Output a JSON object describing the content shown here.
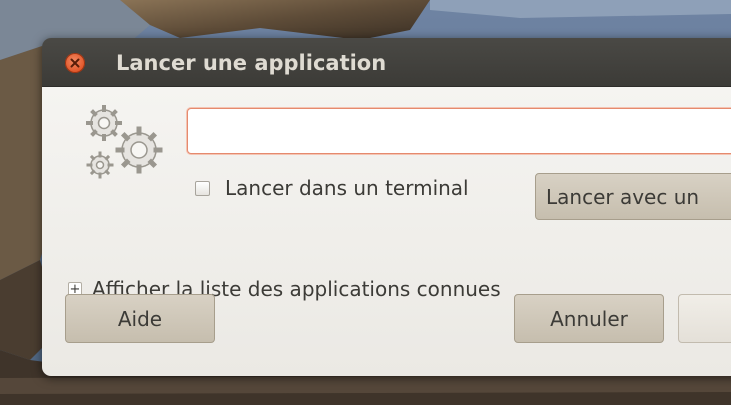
{
  "dialog": {
    "title": "Lancer une application",
    "close_icon": "close-icon",
    "app_icon": "gears-icon"
  },
  "command": {
    "value": "",
    "placeholder": ""
  },
  "terminal": {
    "label": "Lancer dans un terminal",
    "checked": false
  },
  "buttons": {
    "run_with_label": "Lancer avec un",
    "help_label": "Aide",
    "cancel_label": "Annuler",
    "run_label": ""
  },
  "expander": {
    "label": "Afficher la liste des applications connues",
    "icon": "+"
  },
  "colors": {
    "titlebar": "#3c3b37",
    "title_text": "#dfdbd2",
    "close_button": "#e05427",
    "input_focus_border": "#e58a6e",
    "button_fill": "#cfc7b8",
    "content_bg": "#f2f1ee"
  }
}
